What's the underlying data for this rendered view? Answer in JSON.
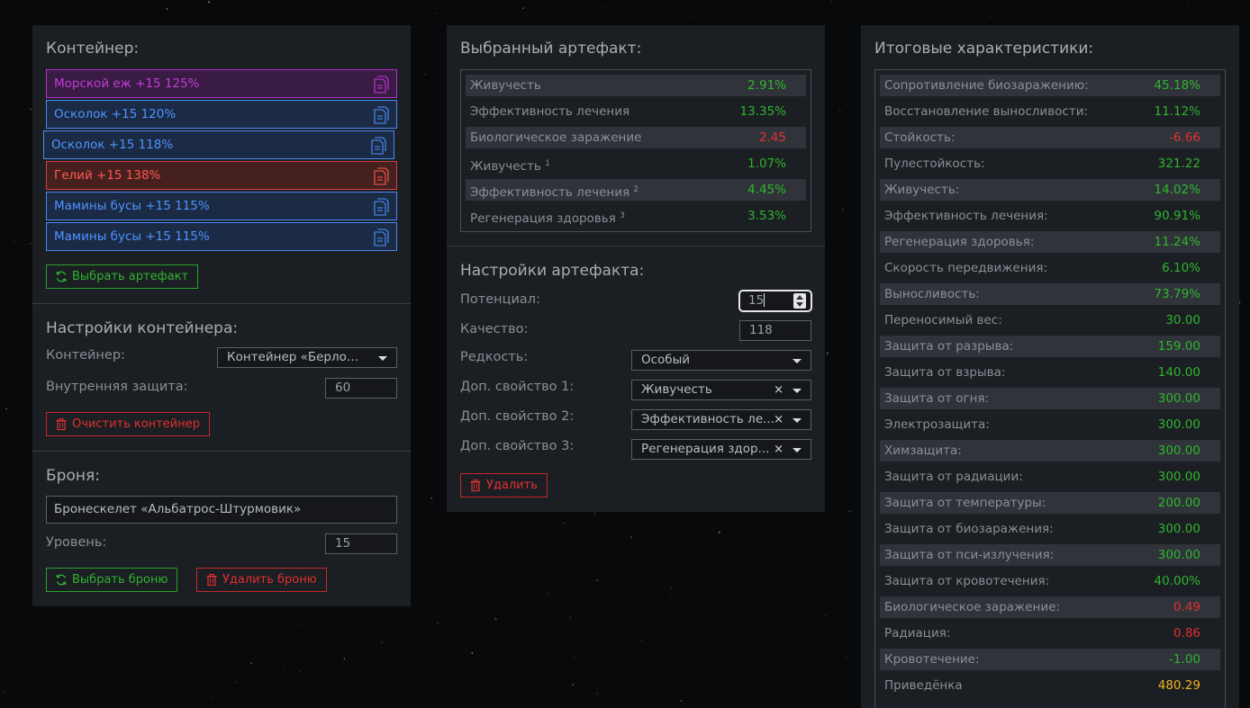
{
  "container_panel": {
    "title": "Контейнер:",
    "artifacts": [
      {
        "label": "Морской еж +15 125%",
        "color": "purple"
      },
      {
        "label": "Осколок +15 120%",
        "color": "blue"
      },
      {
        "label": "Осколок +15 118%",
        "color": "blue",
        "selected": true
      },
      {
        "label": "Гелий +15 138%",
        "color": "red"
      },
      {
        "label": "Мамины бусы +15 115%",
        "color": "blue"
      },
      {
        "label": "Мамины бусы +15 115%",
        "color": "blue"
      }
    ],
    "choose_artifact_label": "Выбрать артефакт"
  },
  "container_settings": {
    "title": "Настройки контейнера:",
    "container_label": "Контейнер:",
    "container_value": "Контейнер «Берлога...",
    "inner_protection_label": "Внутренняя защита:",
    "inner_protection_value": "60",
    "clear_label": "Очистить контейнер"
  },
  "armor": {
    "title": "Броня:",
    "armor_value": "Бронескелет «Альбатрос-Штурмовик»",
    "level_label": "Уровень:",
    "level_value": "15",
    "choose_label": "Выбрать броню",
    "delete_label": "Удалить броню"
  },
  "selected_artifact": {
    "title": "Выбранный артефакт:",
    "stats": [
      {
        "name": "Живучесть",
        "sup": "",
        "value": "2.91%",
        "tone": "pos"
      },
      {
        "name": "Эффективность лечения",
        "sup": "",
        "value": "13.35%",
        "tone": "pos"
      },
      {
        "name": "Биологическое заражение",
        "sup": "",
        "value": "2.45",
        "tone": "neg"
      },
      {
        "name": "Живучесть",
        "sup": "1",
        "value": "1.07%",
        "tone": "pos"
      },
      {
        "name": "Эффективность лечения",
        "sup": "2",
        "value": "4.45%",
        "tone": "pos"
      },
      {
        "name": "Регенерация здоровья",
        "sup": "3",
        "value": "3.53%",
        "tone": "pos"
      }
    ]
  },
  "artifact_settings": {
    "title": "Настройки артефакта:",
    "potential_label": "Потенциал:",
    "potential_value": "15",
    "quality_label": "Качество:",
    "quality_value": "118",
    "rarity_label": "Редкость:",
    "rarity_value": "Особый",
    "extra1_label": "Доп. свойство 1:",
    "extra1_value": "Живучесть",
    "extra2_label": "Доп. свойство 2:",
    "extra2_value": "Эффективность ле...",
    "extra3_label": "Доп. свойство 3:",
    "extra3_value": "Регенерация здор...",
    "clear_symbol": "×",
    "delete_label": "Удалить"
  },
  "totals": {
    "title": "Итоговые характеристики:",
    "stats": [
      {
        "name": "Сопротивление биозаражению:",
        "value": "45.18%",
        "tone": "pos"
      },
      {
        "name": "Восстановление выносливости:",
        "value": "11.12%",
        "tone": "pos"
      },
      {
        "name": "Стойкость:",
        "value": "-6.66",
        "tone": "neg"
      },
      {
        "name": "Пулестойкость:",
        "value": "321.22",
        "tone": "pos"
      },
      {
        "name": "Живучесть:",
        "value": "14.02%",
        "tone": "pos"
      },
      {
        "name": "Эффективность лечения:",
        "value": "90.91%",
        "tone": "pos"
      },
      {
        "name": "Регенерация здоровья:",
        "value": "11.24%",
        "tone": "pos"
      },
      {
        "name": "Скорость передвижения:",
        "value": "6.10%",
        "tone": "pos"
      },
      {
        "name": "Выносливость:",
        "value": "73.79%",
        "tone": "pos"
      },
      {
        "name": "Переносимый вес:",
        "value": "30.00",
        "tone": "pos"
      },
      {
        "name": "Защита от разрыва:",
        "value": "159.00",
        "tone": "pos"
      },
      {
        "name": "Защита от взрыва:",
        "value": "140.00",
        "tone": "pos"
      },
      {
        "name": "Защита от огня:",
        "value": "300.00",
        "tone": "pos"
      },
      {
        "name": "Электрозащита:",
        "value": "300.00",
        "tone": "pos"
      },
      {
        "name": "Химзащита:",
        "value": "300.00",
        "tone": "pos"
      },
      {
        "name": "Защита от радиации:",
        "value": "300.00",
        "tone": "pos"
      },
      {
        "name": "Защита от температуры:",
        "value": "200.00",
        "tone": "pos"
      },
      {
        "name": "Защита от биозаражения:",
        "value": "300.00",
        "tone": "pos"
      },
      {
        "name": "Защита от пси-излучения:",
        "value": "300.00",
        "tone": "pos"
      },
      {
        "name": "Защита от кровотечения:",
        "value": "40.00%",
        "tone": "pos"
      },
      {
        "name": "Биологическое заражение:",
        "value": "0.49",
        "tone": "neg"
      },
      {
        "name": "Радиация:",
        "value": "0.86",
        "tone": "neg"
      },
      {
        "name": "Кровотечение:",
        "value": "-1.00",
        "tone": "pos"
      },
      {
        "name": "Приведёнка",
        "value": "480.29",
        "tone": "gold"
      }
    ]
  },
  "icons": {
    "copy": "copy-icon",
    "refresh": "refresh-icon",
    "trash": "trash-icon"
  }
}
